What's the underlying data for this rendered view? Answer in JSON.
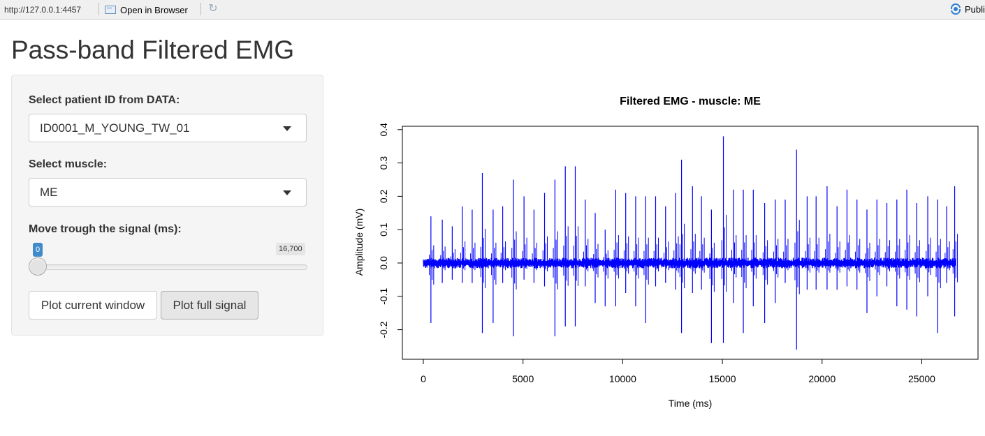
{
  "browser": {
    "url": "http://127.0.0.1:4457",
    "open_in_browser": "Open in Browser",
    "publish": "Publi"
  },
  "page": {
    "title": "Pass-band Filtered EMG"
  },
  "sidebar": {
    "patient_label": "Select patient ID from DATA:",
    "patient_selected": "ID0001_M_YOUNG_TW_01",
    "muscle_label": "Select muscle:",
    "muscle_selected": "ME",
    "slider_label": "Move trough the signal (ms):",
    "slider_value": 0,
    "slider_min_text": "0",
    "slider_max_text": "16,700",
    "btn_current": "Plot current window",
    "btn_full": "Plot full signal"
  },
  "colors": {
    "signal": "#0000ff",
    "accent": "#428bca"
  },
  "icons": {
    "open": "browser-window-icon",
    "refresh": "refresh-icon",
    "publish": "publish-icon"
  },
  "chart_data": {
    "type": "line",
    "title": "Filtered EMG - muscle: ME",
    "xlabel": "Time (ms)",
    "ylabel": "Amplitude (mV)",
    "xlim": [
      0,
      26700
    ],
    "ylim": [
      -0.26,
      0.39
    ],
    "xticks": [
      0,
      5000,
      10000,
      15000,
      20000,
      25000
    ],
    "xtick_labels": [
      "0",
      "5000",
      "10000",
      "15000",
      "20000",
      "25000"
    ],
    "yticks": [
      -0.2,
      -0.1,
      0.0,
      0.1,
      0.2,
      0.3,
      0.4
    ],
    "ytick_labels": [
      "-0.2",
      "-0.1",
      "0.0",
      "0.1",
      "0.2",
      "0.3",
      "0.4"
    ],
    "baseline_noise": 0.008,
    "spikes": [
      {
        "t": 380,
        "hi": 0.14,
        "lo": -0.18
      },
      {
        "t": 950,
        "hi": 0.13,
        "lo": -0.06
      },
      {
        "t": 1450,
        "hi": 0.11,
        "lo": -0.05
      },
      {
        "t": 1950,
        "hi": 0.17,
        "lo": -0.06
      },
      {
        "t": 2450,
        "hi": 0.16,
        "lo": -0.06
      },
      {
        "t": 2960,
        "hi": 0.27,
        "lo": -0.21
      },
      {
        "t": 3500,
        "hi": 0.16,
        "lo": -0.18
      },
      {
        "t": 3980,
        "hi": 0.17,
        "lo": -0.06
      },
      {
        "t": 4520,
        "hi": 0.25,
        "lo": -0.22
      },
      {
        "t": 5050,
        "hi": 0.2,
        "lo": -0.05
      },
      {
        "t": 5550,
        "hi": 0.16,
        "lo": -0.06
      },
      {
        "t": 6080,
        "hi": 0.21,
        "lo": -0.07
      },
      {
        "t": 6600,
        "hi": 0.25,
        "lo": -0.22
      },
      {
        "t": 7120,
        "hi": 0.29,
        "lo": -0.19
      },
      {
        "t": 7620,
        "hi": 0.29,
        "lo": -0.19
      },
      {
        "t": 8120,
        "hi": 0.19,
        "lo": -0.07
      },
      {
        "t": 8620,
        "hi": 0.15,
        "lo": -0.12
      },
      {
        "t": 9120,
        "hi": 0.1,
        "lo": -0.13
      },
      {
        "t": 9650,
        "hi": 0.22,
        "lo": -0.13
      },
      {
        "t": 10150,
        "hi": 0.21,
        "lo": -0.09
      },
      {
        "t": 10650,
        "hi": 0.2,
        "lo": -0.13
      },
      {
        "t": 11150,
        "hi": 0.2,
        "lo": -0.18
      },
      {
        "t": 11650,
        "hi": 0.2,
        "lo": -0.07
      },
      {
        "t": 12150,
        "hi": 0.17,
        "lo": -0.06
      },
      {
        "t": 12650,
        "hi": 0.21,
        "lo": -0.08
      },
      {
        "t": 12950,
        "hi": 0.31,
        "lo": -0.21
      },
      {
        "t": 13500,
        "hi": 0.23,
        "lo": -0.09
      },
      {
        "t": 13950,
        "hi": 0.2,
        "lo": -0.08
      },
      {
        "t": 14450,
        "hi": 0.16,
        "lo": -0.24
      },
      {
        "t": 15050,
        "hi": 0.38,
        "lo": -0.24
      },
      {
        "t": 15550,
        "hi": 0.22,
        "lo": -0.12
      },
      {
        "t": 16050,
        "hi": 0.22,
        "lo": -0.21
      },
      {
        "t": 16550,
        "hi": 0.22,
        "lo": -0.13
      },
      {
        "t": 17120,
        "hi": 0.18,
        "lo": -0.18
      },
      {
        "t": 17650,
        "hi": 0.19,
        "lo": -0.12
      },
      {
        "t": 18150,
        "hi": 0.19,
        "lo": -0.06
      },
      {
        "t": 18720,
        "hi": 0.34,
        "lo": -0.26
      },
      {
        "t": 19250,
        "hi": 0.2,
        "lo": -0.08
      },
      {
        "t": 19700,
        "hi": 0.2,
        "lo": -0.08
      },
      {
        "t": 20250,
        "hi": 0.23,
        "lo": -0.08
      },
      {
        "t": 20750,
        "hi": 0.17,
        "lo": -0.08
      },
      {
        "t": 21250,
        "hi": 0.22,
        "lo": -0.07
      },
      {
        "t": 21750,
        "hi": 0.19,
        "lo": -0.08
      },
      {
        "t": 22250,
        "hi": 0.16,
        "lo": -0.15
      },
      {
        "t": 22750,
        "hi": 0.19,
        "lo": -0.1
      },
      {
        "t": 23250,
        "hi": 0.18,
        "lo": -0.07
      },
      {
        "t": 23750,
        "hi": 0.19,
        "lo": -0.13
      },
      {
        "t": 24250,
        "hi": 0.22,
        "lo": -0.14
      },
      {
        "t": 24750,
        "hi": 0.18,
        "lo": -0.16
      },
      {
        "t": 25300,
        "hi": 0.2,
        "lo": -0.1
      },
      {
        "t": 25800,
        "hi": 0.19,
        "lo": -0.21
      },
      {
        "t": 26250,
        "hi": 0.17,
        "lo": -0.06
      },
      {
        "t": 26650,
        "hi": 0.23,
        "lo": -0.16
      }
    ]
  }
}
